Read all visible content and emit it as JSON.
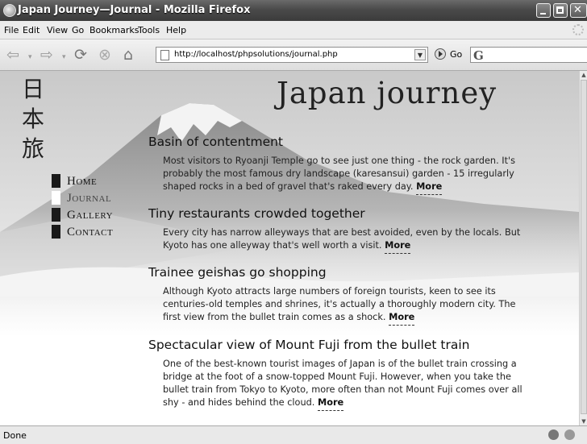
{
  "window": {
    "title": "Japan Journey—Journal - Mozilla Firefox"
  },
  "menu": [
    "File",
    "Edit",
    "View",
    "Go",
    "Bookmarks",
    "Tools",
    "Help"
  ],
  "toolbar": {
    "url": "http://localhost/phpsolutions/journal.php",
    "go_label": "Go",
    "search_engine_icon": "G"
  },
  "site": {
    "title": "Japan journey",
    "kanji": [
      "日",
      "本",
      "旅"
    ]
  },
  "nav": [
    {
      "label": "Home",
      "current": false
    },
    {
      "label": "Journal",
      "current": true
    },
    {
      "label": "Gallery",
      "current": false
    },
    {
      "label": "Contact",
      "current": false
    }
  ],
  "articles": [
    {
      "title": "Basin of contentment",
      "body": "Most visitors to Ryoanji Temple go to see just one thing - the rock garden. It's probably the most famous dry landscape (karesansui) garden - 15 irregularly shaped rocks in a bed of gravel that's raked every day.",
      "more": "More"
    },
    {
      "title": "Tiny restaurants crowded together",
      "body": "Every city has narrow alleyways that are best avoided, even by the locals. But Kyoto has one alleyway that's well worth a visit.",
      "more": "More"
    },
    {
      "title": "Trainee geishas go shopping",
      "body": "Although Kyoto attracts large numbers of foreign tourists, keen to see its centuries-old temples and shrines, it's actually a thoroughly modern city. The first view from the bullet train comes as a shock.",
      "more": "More"
    },
    {
      "title": "Spectacular view of Mount Fuji from the bullet train",
      "body": "One of the best-known tourist images of Japan is of the bullet train crossing a bridge at the foot of a snow-topped Mount Fuji. However, when you take the bullet train from Tokyo to Kyoto, more often than not Mount Fuji comes over all shy - and hides behind the cloud.",
      "more": "More"
    }
  ],
  "status": {
    "text": "Done"
  }
}
